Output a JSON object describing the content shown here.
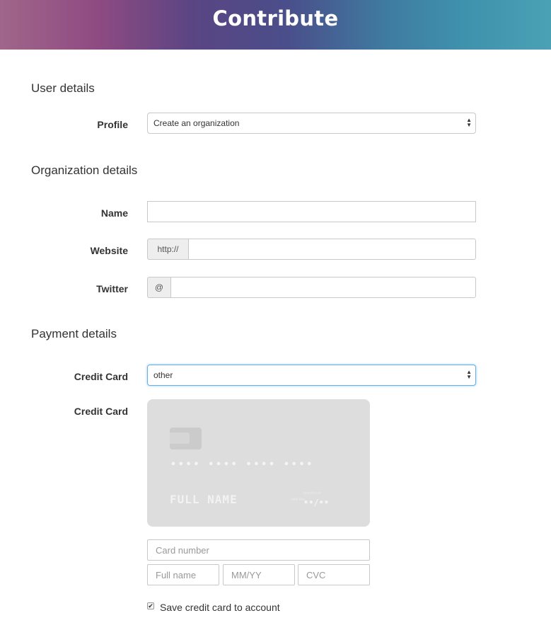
{
  "header": {
    "title": "Contribute"
  },
  "sections": {
    "user": "User details",
    "organization": "Organization details",
    "payment": "Payment details"
  },
  "profile": {
    "label": "Profile",
    "selected": "Create an organization"
  },
  "org": {
    "name_label": "Name",
    "website_label": "Website",
    "website_prefix": "http://",
    "twitter_label": "Twitter",
    "twitter_prefix": "@"
  },
  "payment": {
    "card_select_label": "Credit Card",
    "card_select_value": "other",
    "card_preview_label": "Credit Card",
    "preview": {
      "number_groups": [
        "••••",
        "••••",
        "••••",
        "••••"
      ],
      "name": "FULL NAME",
      "expiry": "••/••",
      "valid_thru": "valid thru",
      "month_year": "month/year"
    },
    "card_number_placeholder": "Card number",
    "full_name_placeholder": "Full name",
    "expiry_placeholder": "MM/YY",
    "cvc_placeholder": "CVC",
    "save_label": "Save credit card to account",
    "save_checked": true
  }
}
